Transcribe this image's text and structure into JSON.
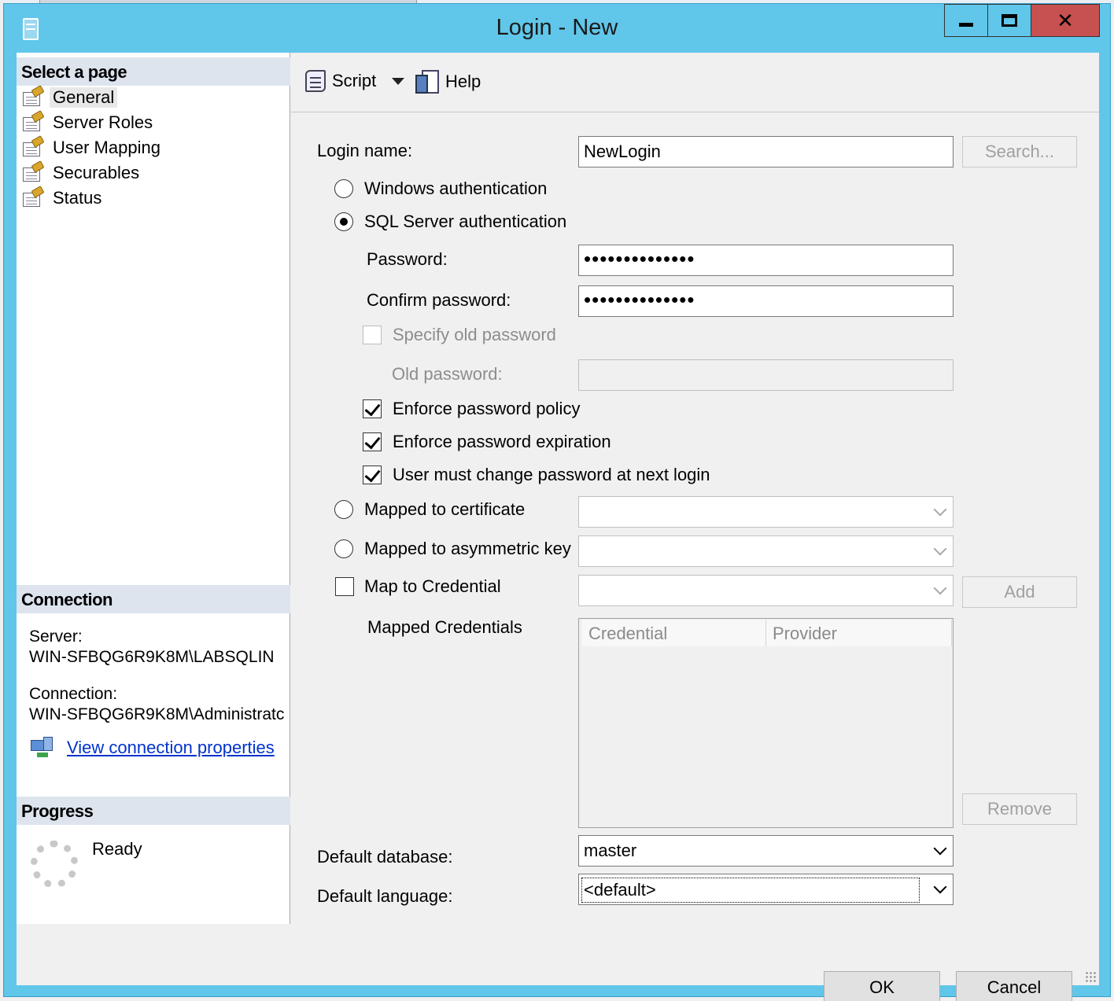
{
  "window": {
    "title": "Login - New"
  },
  "left_panel": {
    "select_page_header": "Select a page",
    "pages": [
      {
        "label": "General",
        "selected": true,
        "icon": "page-settings-icon"
      },
      {
        "label": "Server Roles",
        "icon": "page-settings-icon"
      },
      {
        "label": "User Mapping",
        "icon": "page-settings-icon"
      },
      {
        "label": "Securables",
        "icon": "page-settings-icon"
      },
      {
        "label": "Status",
        "icon": "page-settings-icon"
      }
    ],
    "connection_header": "Connection",
    "server_label": "Server:",
    "server_value": "WIN-SFBQG6R9K8M\\LABSQLIN",
    "connection_label": "Connection:",
    "connection_value": "WIN-SFBQG6R9K8M\\Administratc",
    "view_connection_link": "View connection properties",
    "progress_header": "Progress",
    "progress_status": "Ready"
  },
  "toolbar": {
    "script_label": "Script",
    "help_label": "Help"
  },
  "form": {
    "login_name_label": "Login name:",
    "login_name_value": "NewLogin",
    "search_button": "Search...",
    "windows_auth_label": "Windows authentication",
    "sql_auth_label": "SQL Server authentication",
    "password_label": "Password:",
    "password_value": "••••••••••••••",
    "confirm_password_label": "Confirm password:",
    "confirm_password_value": "••••••••••••••",
    "specify_old_password_label": "Specify old password",
    "old_password_label": "Old password:",
    "enforce_policy_label": "Enforce password policy",
    "enforce_expiration_label": "Enforce password expiration",
    "must_change_label": "User must change password at next login",
    "mapped_cert_label": "Mapped to certificate",
    "mapped_asym_label": "Mapped to asymmetric key",
    "map_credential_label": "Map to Credential",
    "add_button": "Add",
    "mapped_credentials_label": "Mapped Credentials",
    "credentials_columns": [
      "Credential",
      "Provider"
    ],
    "remove_button": "Remove",
    "default_database_label": "Default database:",
    "default_database_value": "master",
    "default_language_label": "Default language:",
    "default_language_value": "<default>"
  },
  "footer": {
    "ok_button": "OK",
    "cancel_button": "Cancel"
  },
  "colors": {
    "title_bar": "#60c6ea",
    "close_button": "#c75050",
    "section_header": "#dde4ee",
    "link": "#0033cc"
  }
}
